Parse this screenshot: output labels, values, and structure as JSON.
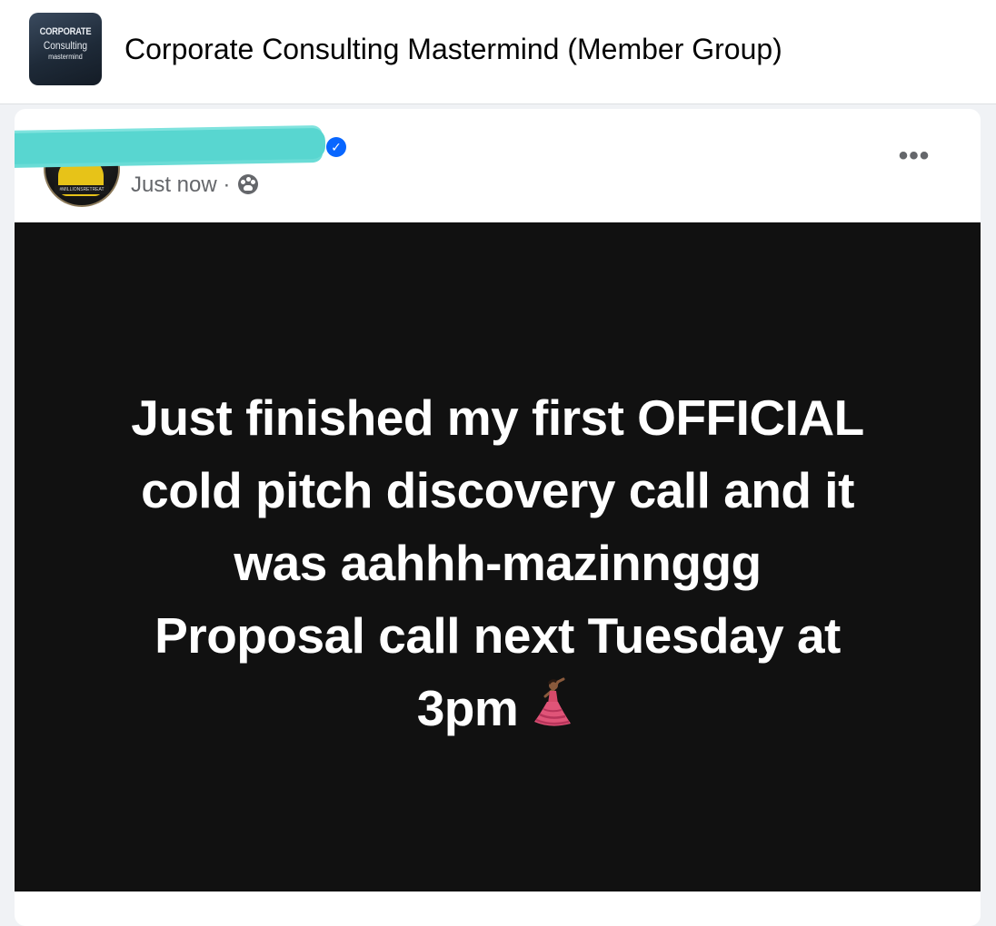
{
  "group": {
    "logo_line1": "CORPORATE",
    "logo_line2": "Consulting",
    "logo_line3": "mastermind",
    "title": "Corporate Consulting Mastermind (Member Group)"
  },
  "post": {
    "author_badge_text": "#MILLIONSRETREAT",
    "timestamp": "Just now",
    "separator": "·",
    "audience_icon": "group-audience-icon",
    "verified_icon": "verified-badge-icon",
    "more_label": "•••",
    "text_lines": [
      "Just finished my first OFFICIAL",
      "cold pitch discovery call and it",
      "was aahhh-mazinnggg",
      "Proposal call next Tuesday at",
      "3pm"
    ],
    "emoji": "dancer-emoji",
    "background_color": "#111111"
  }
}
